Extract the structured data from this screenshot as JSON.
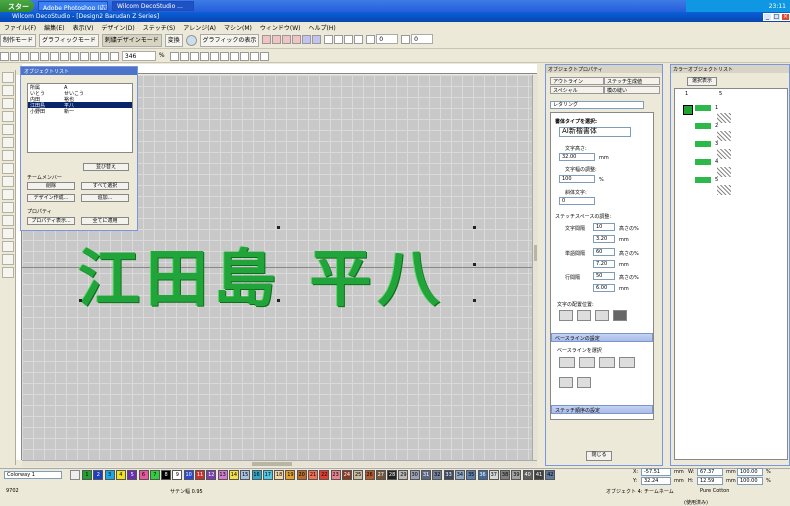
{
  "taskbar": {
    "start": "スタート",
    "tasks": [
      "Adobe Photoshop (応答...",
      "Wilcom DecoStudio ..."
    ],
    "time": "23:11"
  },
  "window": {
    "title": "Wilcom DecoStudio - [Design2                    Barudan Z Series]"
  },
  "menu": [
    "ファイル(F)",
    "編集(E)",
    "表示(V)",
    "デザイン(D)",
    "ステッチ(S)",
    "アレンジ(A)",
    "マシン(M)",
    "ウィンドウ(W)",
    "ヘルプ(H)"
  ],
  "toolbar1": {
    "mode1": "制作モード",
    "mode2": "グラフィックモード",
    "mode3": "刺繍デザインモード",
    "convert": "変換",
    "graphic_display": "グラフィックの表示",
    "rotate_value": "0",
    "zoom_value": "0"
  },
  "toolbar2": {
    "zoom": "346",
    "unit": "%"
  },
  "overview": {
    "title": "オブジェクトリスト",
    "columns": [
      "",
      ""
    ],
    "rows": [
      [
        "所属",
        "A"
      ],
      [
        "いとう",
        "せいこう"
      ],
      [
        "内田",
        "裕也"
      ],
      [
        "江田島",
        "平八"
      ],
      [
        "小野田",
        "新一"
      ]
    ],
    "selected_index": 3,
    "grp_label": "チームメンバー",
    "btn_delete": "削除",
    "btn_select_all": "すべて選択",
    "btn_design": "デザイン作成...",
    "btn_add": "追加...",
    "prop_label": "プロパティ",
    "btn_props": "プロパティ表示...",
    "btn_apply_all": "全てに適用",
    "btn_search": "並び替え"
  },
  "canvas": {
    "text": "江田島 平八"
  },
  "props": {
    "title": "オブジェクトプロパティ",
    "tabs": [
      "アウトライン",
      "ステッチ生成値",
      "スペシャル",
      "模の縫い"
    ],
    "lettering": "レタリング",
    "font_select_label": "書体タイプを選択:",
    "font": "AI新楷書体",
    "height_label": "文字高さ:",
    "height": "32.00",
    "height_unit": "mm",
    "width_label": "文字幅の調整:",
    "width": "100",
    "width_unit": "%",
    "italic_label": "斜体文字:",
    "italic": "0",
    "spacing_label": "ステッチスペースの調整:",
    "char_spacing_label": "文字間隔",
    "char_spacing": "10",
    "char_spacing_unit": "高さの%",
    "char_spacing_mm": "3.20",
    "word_spacing_label": "単語間隔",
    "word_spacing": "60",
    "word_spacing_unit": "高さの%",
    "word_spacing_mm": "7.20",
    "line_spacing_label": "行間隔",
    "line_spacing": "50",
    "line_spacing_unit": "高さの%",
    "line_spacing_mm": "6.00",
    "mm": "mm",
    "align_label": "文字の配置位置:",
    "baseline_section": "ベースラインの設定",
    "baseline_select": "ベースラインを選択",
    "stitch_section": "ステッチ順序の設定",
    "close": "閉じる"
  },
  "colorlist": {
    "title": "カラーオブジェクトリスト",
    "show_btn": "選択表示",
    "col1": "1",
    "col2": "5",
    "rows": [
      "1",
      "2",
      "3",
      "4",
      "5"
    ]
  },
  "status": {
    "colorway": "Colorway 1",
    "stitches": "9702",
    "satin_width": "サテン幅 0.95",
    "objects": "オブジェクト 4: チームネーム",
    "x_label": "X:",
    "x": "-57.51",
    "y_label": "Y:",
    "y": "32.24",
    "w_label": "W:",
    "w": "67.37",
    "h_label": "H:",
    "h": "12.59",
    "w_mm": "100.00",
    "h_mm": "100.00",
    "pct": "%",
    "mm": "mm",
    "thread": "Pure Cotton",
    "in_use": "(使用済み)"
  },
  "swatches": [
    {
      "n": "1",
      "c": "#1fa32e"
    },
    {
      "n": "2",
      "c": "#1c3fbf"
    },
    {
      "n": "3",
      "c": "#17a8e6"
    },
    {
      "n": "4",
      "c": "#f2e21c"
    },
    {
      "n": "5",
      "c": "#6a2fb0"
    },
    {
      "n": "6",
      "c": "#e8579d"
    },
    {
      "n": "7",
      "c": "#2fcf3c"
    },
    {
      "n": "8",
      "c": "#000000"
    },
    {
      "n": "9",
      "c": "#ffffff"
    },
    {
      "n": "10",
      "c": "#2a4ad6"
    },
    {
      "n": "11",
      "c": "#c4332c"
    },
    {
      "n": "12",
      "c": "#7b3db0"
    },
    {
      "n": "13",
      "c": "#d47bd0"
    },
    {
      "n": "14",
      "c": "#f5e046"
    },
    {
      "n": "15",
      "c": "#a7c1e3"
    },
    {
      "n": "16",
      "c": "#29a7c8"
    },
    {
      "n": "17",
      "c": "#4fc8e8"
    },
    {
      "n": "18",
      "c": "#f4d5a5"
    },
    {
      "n": "19",
      "c": "#e6a027"
    },
    {
      "n": "20",
      "c": "#b96a2b"
    },
    {
      "n": "21",
      "c": "#f56f53"
    },
    {
      "n": "22",
      "c": "#e13c30"
    },
    {
      "n": "23",
      "c": "#e9828e"
    },
    {
      "n": "24",
      "c": "#8b3a22"
    },
    {
      "n": "25",
      "c": "#c8b9a0"
    },
    {
      "n": "26",
      "c": "#b45a2c"
    },
    {
      "n": "27",
      "c": "#72553a"
    },
    {
      "n": "28",
      "c": "#222222"
    },
    {
      "n": "29",
      "c": "#b8b8b8"
    },
    {
      "n": "30",
      "c": "#9aa3b5"
    },
    {
      "n": "31",
      "c": "#5b6680"
    },
    {
      "n": "32",
      "c": "#6f7f96"
    },
    {
      "n": "33",
      "c": "#3d4a61"
    },
    {
      "n": "34",
      "c": "#8fa7c6"
    },
    {
      "n": "35",
      "c": "#5a7fae"
    },
    {
      "n": "36",
      "c": "#3f6a9a"
    },
    {
      "n": "37",
      "c": "#d7d7d7"
    },
    {
      "n": "38",
      "c": "#808080"
    },
    {
      "n": "39",
      "c": "#a0a0a0"
    },
    {
      "n": "40",
      "c": "#606060"
    },
    {
      "n": "41",
      "c": "#404040"
    },
    {
      "n": "42",
      "c": "#5b7a9c"
    }
  ]
}
